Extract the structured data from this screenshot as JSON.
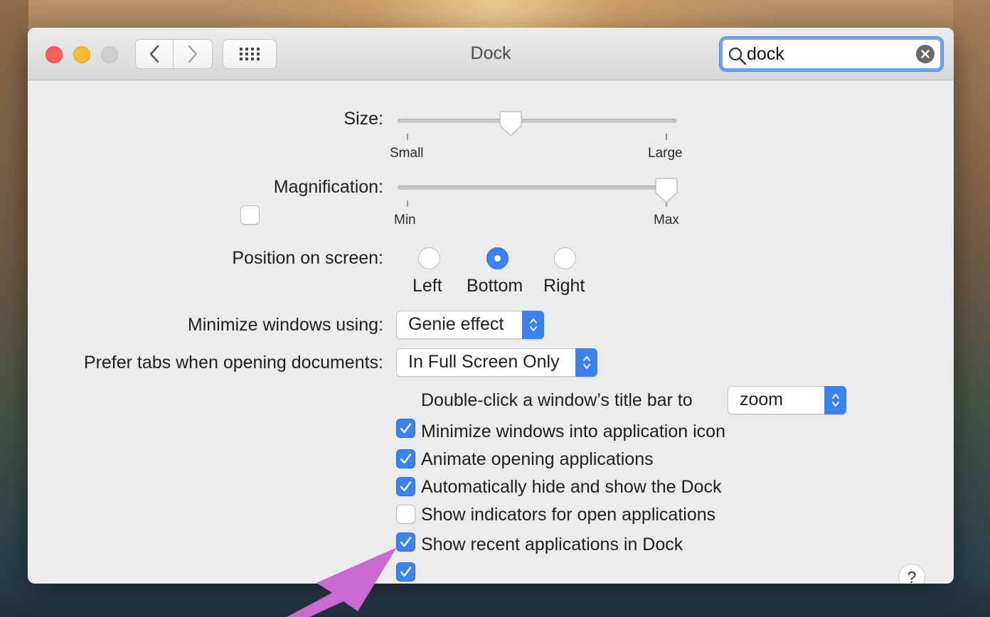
{
  "window": {
    "title": "Dock"
  },
  "search": {
    "value": "dock"
  },
  "size": {
    "label": "Size:",
    "min_label": "Small",
    "max_label": "Large",
    "value_fraction": 0.4
  },
  "magnification": {
    "label": "Magnification:",
    "checked": false,
    "min_label": "Min",
    "max_label": "Max",
    "value_fraction": 1.0
  },
  "position": {
    "label": "Position on screen:",
    "options": [
      {
        "label": "Left",
        "selected": false
      },
      {
        "label": "Bottom",
        "selected": true
      },
      {
        "label": "Right",
        "selected": false
      }
    ]
  },
  "minimize": {
    "label": "Minimize windows using:",
    "value": "Genie effect"
  },
  "prefer_tabs": {
    "label": "Prefer tabs when opening documents:",
    "value": "In Full Screen Only"
  },
  "double_click": {
    "label": "Double-click a window’s title bar to",
    "checked": true,
    "value": "zoom"
  },
  "options": [
    {
      "label": "Minimize windows into application icon",
      "checked": true
    },
    {
      "label": "Animate opening applications",
      "checked": true
    },
    {
      "label": "Automatically hide and show the Dock",
      "checked": false
    },
    {
      "label": "Show indicators for open applications",
      "checked": true
    },
    {
      "label": "Show recent applications in Dock",
      "checked": true
    }
  ],
  "help": {
    "label": "?"
  },
  "colors": {
    "accent": "#3b83f3",
    "annotation_arrow": "#c86ad2"
  }
}
